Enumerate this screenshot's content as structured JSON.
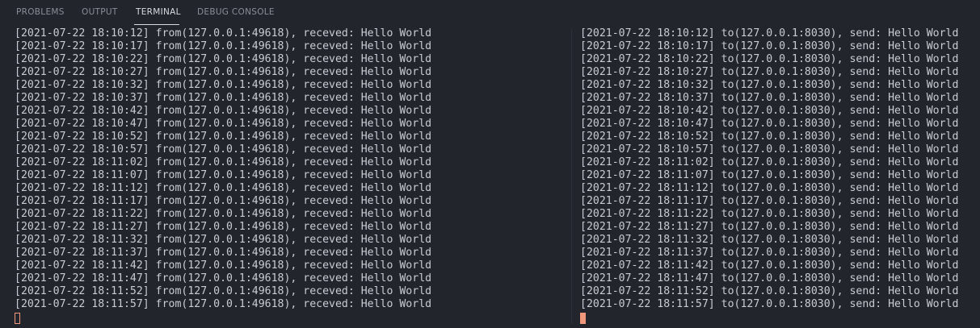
{
  "panel_tabs": {
    "problems": "PROBLEMS",
    "output": "OUTPUT",
    "terminal": "TERMINAL",
    "debug_console": "DEBUG CONSOLE"
  },
  "colors": {
    "background": "#22252c",
    "text": "#c8ccd3",
    "tab_inactive": "#8a8e97",
    "tab_active": "#d7dae0",
    "cursor": "#f1977c"
  },
  "terminal_left": {
    "lines": [
      "[2021-07-22 18:10:12] from(127.0.0.1:49618), receved: Hello World",
      "[2021-07-22 18:10:17] from(127.0.0.1:49618), receved: Hello World",
      "[2021-07-22 18:10:22] from(127.0.0.1:49618), receved: Hello World",
      "[2021-07-22 18:10:27] from(127.0.0.1:49618), receved: Hello World",
      "[2021-07-22 18:10:32] from(127.0.0.1:49618), receved: Hello World",
      "[2021-07-22 18:10:37] from(127.0.0.1:49618), receved: Hello World",
      "[2021-07-22 18:10:42] from(127.0.0.1:49618), receved: Hello World",
      "[2021-07-22 18:10:47] from(127.0.0.1:49618), receved: Hello World",
      "[2021-07-22 18:10:52] from(127.0.0.1:49618), receved: Hello World",
      "[2021-07-22 18:10:57] from(127.0.0.1:49618), receved: Hello World",
      "[2021-07-22 18:11:02] from(127.0.0.1:49618), receved: Hello World",
      "[2021-07-22 18:11:07] from(127.0.0.1:49618), receved: Hello World",
      "[2021-07-22 18:11:12] from(127.0.0.1:49618), receved: Hello World",
      "[2021-07-22 18:11:17] from(127.0.0.1:49618), receved: Hello World",
      "[2021-07-22 18:11:22] from(127.0.0.1:49618), receved: Hello World",
      "[2021-07-22 18:11:27] from(127.0.0.1:49618), receved: Hello World",
      "[2021-07-22 18:11:32] from(127.0.0.1:49618), receved: Hello World",
      "[2021-07-22 18:11:37] from(127.0.0.1:49618), receved: Hello World",
      "[2021-07-22 18:11:42] from(127.0.0.1:49618), receved: Hello World",
      "[2021-07-22 18:11:47] from(127.0.0.1:49618), receved: Hello World",
      "[2021-07-22 18:11:52] from(127.0.0.1:49618), receved: Hello World",
      "[2021-07-22 18:11:57] from(127.0.0.1:49618), receved: Hello World"
    ]
  },
  "terminal_right": {
    "lines": [
      "[2021-07-22 18:10:12] to(127.0.0.1:8030), send: Hello World",
      "[2021-07-22 18:10:17] to(127.0.0.1:8030), send: Hello World",
      "[2021-07-22 18:10:22] to(127.0.0.1:8030), send: Hello World",
      "[2021-07-22 18:10:27] to(127.0.0.1:8030), send: Hello World",
      "[2021-07-22 18:10:32] to(127.0.0.1:8030), send: Hello World",
      "[2021-07-22 18:10:37] to(127.0.0.1:8030), send: Hello World",
      "[2021-07-22 18:10:42] to(127.0.0.1:8030), send: Hello World",
      "[2021-07-22 18:10:47] to(127.0.0.1:8030), send: Hello World",
      "[2021-07-22 18:10:52] to(127.0.0.1:8030), send: Hello World",
      "[2021-07-22 18:10:57] to(127.0.0.1:8030), send: Hello World",
      "[2021-07-22 18:11:02] to(127.0.0.1:8030), send: Hello World",
      "[2021-07-22 18:11:07] to(127.0.0.1:8030), send: Hello World",
      "[2021-07-22 18:11:12] to(127.0.0.1:8030), send: Hello World",
      "[2021-07-22 18:11:17] to(127.0.0.1:8030), send: Hello World",
      "[2021-07-22 18:11:22] to(127.0.0.1:8030), send: Hello World",
      "[2021-07-22 18:11:27] to(127.0.0.1:8030), send: Hello World",
      "[2021-07-22 18:11:32] to(127.0.0.1:8030), send: Hello World",
      "[2021-07-22 18:11:37] to(127.0.0.1:8030), send: Hello World",
      "[2021-07-22 18:11:42] to(127.0.0.1:8030), send: Hello World",
      "[2021-07-22 18:11:47] to(127.0.0.1:8030), send: Hello World",
      "[2021-07-22 18:11:52] to(127.0.0.1:8030), send: Hello World",
      "[2021-07-22 18:11:57] to(127.0.0.1:8030), send: Hello World"
    ]
  }
}
